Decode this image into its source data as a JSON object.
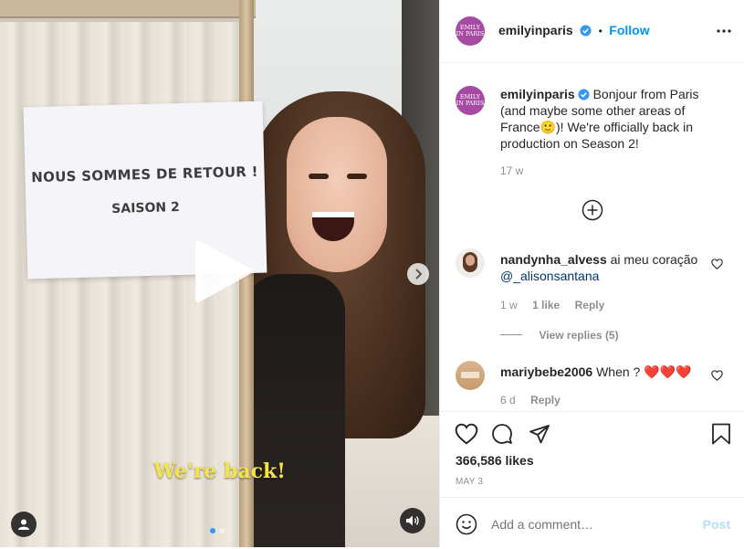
{
  "media": {
    "sign_line1": "NOUS SOMMES DE RETOUR !",
    "sign_line2": "SAISON 2",
    "caption": "We're back!",
    "carousel_active_index": 0,
    "carousel_count": 2
  },
  "post": {
    "username": "emilyinparis",
    "follow_label": "Follow",
    "separator": "•",
    "avatar_line1": "EMILY",
    "avatar_line2": "IN PARIS",
    "caption_text": "Bonjour from Paris (and maybe some other areas of France🙂)! We're officially back in production on Season 2!",
    "caption_time": "17 w",
    "likes": "366,586 likes",
    "date": "MAY 3"
  },
  "comments": [
    {
      "username": "nandynha_alvess",
      "text": "ai meu coração",
      "mention": "@_alisonsantana",
      "time": "1 w",
      "likes": "1 like",
      "reply_label": "Reply",
      "view_replies": "View replies (5)"
    },
    {
      "username": "mariybebe2006",
      "text": "When ?",
      "hearts": "❤️❤️❤️",
      "time": "6 d",
      "reply_label": "Reply"
    }
  ],
  "add_comment": {
    "placeholder": "Add a comment…",
    "post_label": "Post"
  },
  "colors": {
    "accent": "#0095f6",
    "avatar": "#a64aa3",
    "caption_yellow": "#f4e34a"
  },
  "icons": [
    "play-icon",
    "chevron-right-icon",
    "user-tag-icon",
    "volume-icon",
    "verified-icon",
    "more-icon",
    "plus-circle-icon",
    "heart-icon",
    "comment-icon",
    "share-icon",
    "bookmark-icon",
    "emoji-icon"
  ]
}
